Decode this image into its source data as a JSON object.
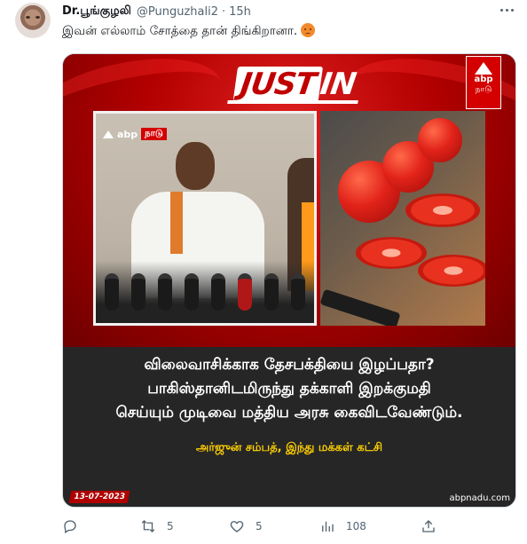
{
  "tweet": {
    "display_name": "Dr.பூங்குழலி",
    "handle": "@Punguzhali2",
    "separator": "·",
    "time": "15h",
    "text": "இவன் எல்லாம் சோத்தை தான் திங்கிறானா."
  },
  "media": {
    "banner_just": "JUST",
    "banner_in": "IN",
    "logo_abp": "abp",
    "logo_nadu": "நாடு",
    "chip_abp": "abp",
    "chip_nadu": "நாடு",
    "caption_line1": "விலைவாசிக்காக தேசபக்தியை இழப்பதா?",
    "caption_line2": "பாகிஸ்தானிடமிருந்து தக்காளி இறக்குமதி",
    "caption_line3": "செய்யும் முடிவை மத்திய அரசு கைவிடவேண்டும்.",
    "attribution": "அர்ஜுன் சம்பத், இந்து மக்கள் கட்சி",
    "date": "13-07-2023",
    "site": "abpnadu.com"
  },
  "actions": {
    "reply_count": "",
    "retweet_count": "5",
    "like_count": "5",
    "views_count": "108"
  },
  "icons": [
    "more-icon",
    "reply-icon",
    "retweet-icon",
    "like-icon",
    "views-icon",
    "share-icon"
  ]
}
